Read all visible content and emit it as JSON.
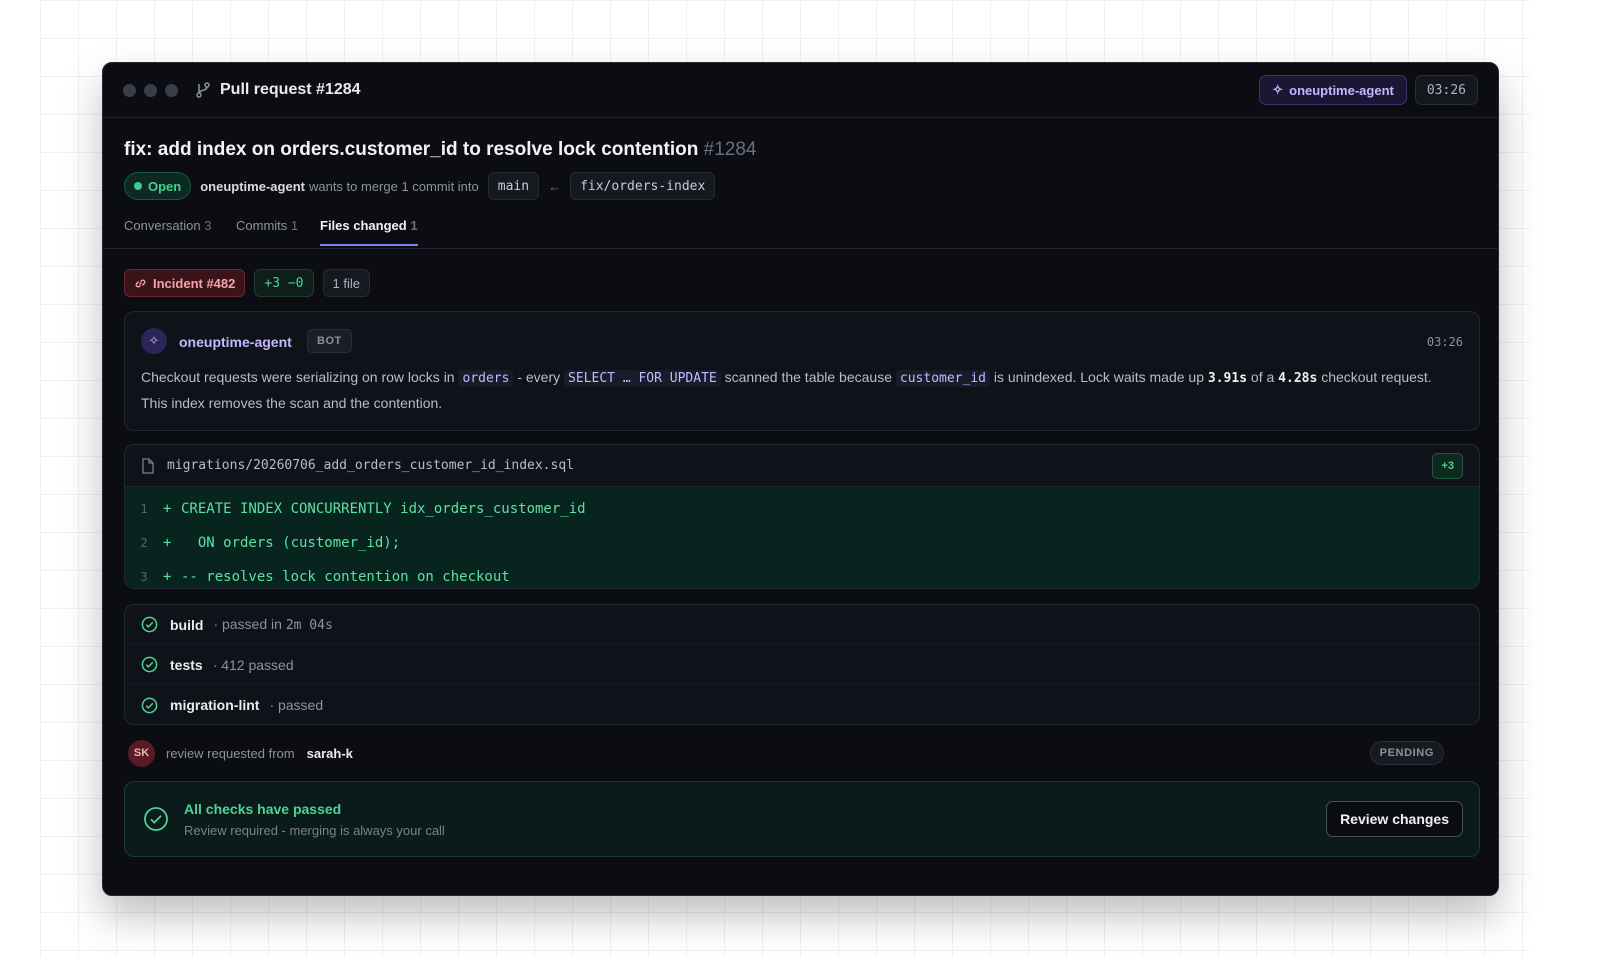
{
  "window": {
    "title": "Pull request #1284",
    "agent_label": "oneuptime-agent",
    "time": "03:26"
  },
  "pr": {
    "title": "fix: add index on orders.customer_id to resolve lock contention",
    "number": "#1284",
    "status": "Open",
    "author": "oneuptime-agent",
    "merge_text": "wants to merge 1 commit into",
    "base_branch": "main",
    "arrow": "←",
    "head_branch": "fix/orders-index"
  },
  "tabs": [
    {
      "label": "Conversation",
      "count": "3"
    },
    {
      "label": "Commits",
      "count": "1"
    },
    {
      "label": "Files changed",
      "count": "1"
    }
  ],
  "tags": {
    "incident": "Incident #482",
    "diff": "+3 −0",
    "files": "1 file"
  },
  "comment": {
    "author": "oneuptime-agent",
    "badge": "BOT",
    "time": "03:26",
    "body": {
      "t1": "Checkout requests were serializing on row locks in ",
      "c1": "orders",
      "t2": " - every ",
      "c2": "SELECT … FOR UPDATE",
      "t3": " scanned the table because ",
      "c3": "customer_id",
      "t4": " is unindexed. Lock waits made up ",
      "b1": "3.91s",
      "t5": " of a ",
      "b2": "4.28s",
      "t6": " checkout request. This index removes the scan and the contention."
    }
  },
  "file": {
    "path": "migrations/20260706_add_orders_customer_id_index.sql",
    "additions": "+3",
    "lines": [
      {
        "num": "1",
        "sign": "+",
        "code": "CREATE INDEX CONCURRENTLY idx_orders_customer_id"
      },
      {
        "num": "2",
        "sign": "+",
        "code": "  ON orders (customer_id);"
      },
      {
        "num": "3",
        "sign": "+",
        "code": "-- resolves lock contention on checkout"
      }
    ]
  },
  "checks": [
    {
      "name": "build",
      "status_prefix": "· passed in ",
      "status_mono": "2m 04s"
    },
    {
      "name": "tests",
      "status_prefix": "· 412 passed",
      "status_mono": ""
    },
    {
      "name": "migration-lint",
      "status_prefix": "· passed",
      "status_mono": ""
    }
  ],
  "review": {
    "initials": "SK",
    "text": "review requested from",
    "user": "sarah-k",
    "state": "PENDING"
  },
  "merge": {
    "title": "All checks have passed",
    "subtitle": "Review required - merging is always your call",
    "button": "Review changes"
  },
  "colors": {
    "accent": "#8b7cf6",
    "success": "#4fd394",
    "danger": "#f3a3ab",
    "background": "#0b0d13"
  }
}
